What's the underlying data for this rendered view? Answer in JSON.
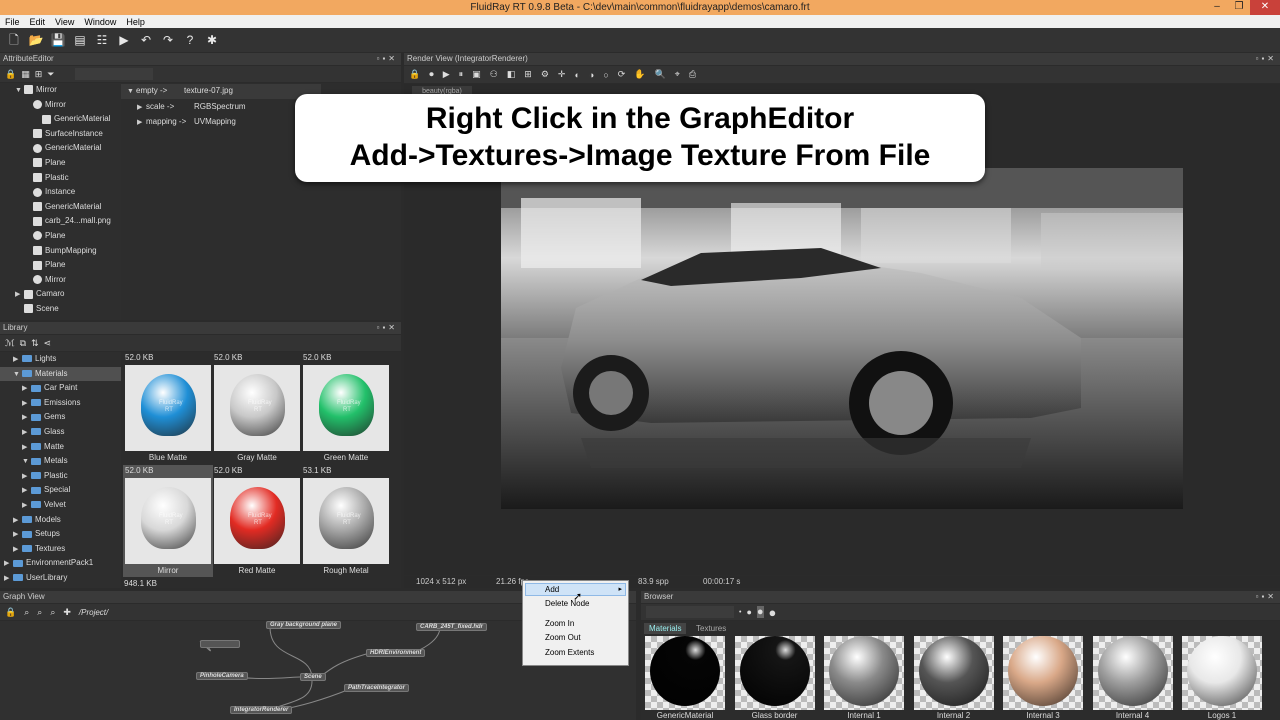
{
  "window": {
    "title": "FluidRay RT 0.9.8 Beta - C:\\dev\\main\\common\\fluidrayapp\\demos\\camaro.frt",
    "controls": [
      "–",
      "❐",
      "✕"
    ]
  },
  "menu": [
    "File",
    "Edit",
    "View",
    "Window",
    "Help"
  ],
  "attribute_editor": {
    "title": "AttributeEditor",
    "tree": [
      {
        "label": "Mirror",
        "indent": 1,
        "arrow": "▼"
      },
      {
        "label": "Mirror",
        "indent": 2,
        "arrow": ""
      },
      {
        "label": "GenericMaterial",
        "indent": 3,
        "arrow": ""
      },
      {
        "label": "SurfaceInstance",
        "indent": 2,
        "arrow": ""
      },
      {
        "label": "GenericMaterial",
        "indent": 2,
        "arrow": ""
      },
      {
        "label": "Plane",
        "indent": 2,
        "arrow": ""
      },
      {
        "label": "Plastic",
        "indent": 2,
        "arrow": ""
      },
      {
        "label": "Instance",
        "indent": 2,
        "arrow": ""
      },
      {
        "label": "GenericMaterial",
        "indent": 2,
        "arrow": ""
      },
      {
        "label": "carb_24...mall.png",
        "indent": 2,
        "arrow": ""
      },
      {
        "label": "Plane",
        "indent": 2,
        "arrow": ""
      },
      {
        "label": "BumpMapping",
        "indent": 2,
        "arrow": ""
      },
      {
        "label": "Plane",
        "indent": 2,
        "arrow": ""
      },
      {
        "label": "Mirror",
        "indent": 2,
        "arrow": ""
      },
      {
        "label": "Camaro",
        "indent": 1,
        "arrow": "▶"
      },
      {
        "label": "Scene",
        "indent": 1,
        "arrow": ""
      }
    ],
    "props": [
      {
        "key": "empty ->",
        "value": "texture-07.jpg",
        "arrow": "▼"
      },
      {
        "key": "scale ->",
        "value": "RGBSpectrum",
        "arrow": "▶"
      },
      {
        "key": "mapping ->",
        "value": "UVMapping",
        "arrow": "▶"
      }
    ]
  },
  "library": {
    "title": "Library",
    "tree": [
      {
        "label": "Lights",
        "indent": 1,
        "arrow": "▶"
      },
      {
        "label": "Materials",
        "indent": 1,
        "arrow": "▼",
        "selected": true
      },
      {
        "label": "Car Paint",
        "indent": 2,
        "arrow": "▶"
      },
      {
        "label": "Emissions",
        "indent": 2,
        "arrow": "▶"
      },
      {
        "label": "Gems",
        "indent": 2,
        "arrow": "▶"
      },
      {
        "label": "Glass",
        "indent": 2,
        "arrow": "▶"
      },
      {
        "label": "Matte",
        "indent": 2,
        "arrow": "▶"
      },
      {
        "label": "Metals",
        "indent": 2,
        "arrow": "▼"
      },
      {
        "label": "Plastic",
        "indent": 2,
        "arrow": "▶"
      },
      {
        "label": "Special",
        "indent": 2,
        "arrow": "▶"
      },
      {
        "label": "Velvet",
        "indent": 2,
        "arrow": "▶"
      },
      {
        "label": "Models",
        "indent": 1,
        "arrow": "▶"
      },
      {
        "label": "Setups",
        "indent": 1,
        "arrow": "▶"
      },
      {
        "label": "Textures",
        "indent": 1,
        "arrow": "▶"
      },
      {
        "label": "EnvironmentPack1",
        "indent": 0,
        "arrow": "▶"
      },
      {
        "label": "UserLibrary",
        "indent": 0,
        "arrow": "▶"
      }
    ],
    "items": [
      {
        "size": "52.0 KB",
        "name": "Blue Matte",
        "color": "#1f8fd6"
      },
      {
        "size": "52.0 KB",
        "name": "Gray Matte",
        "color": "#c8c8c8"
      },
      {
        "size": "52.0 KB",
        "name": "Green Matte",
        "color": "#22c06a"
      },
      {
        "size": "52.0 KB",
        "name": "Mirror",
        "color": "#d8d8d8"
      },
      {
        "size": "52.0 KB",
        "name": "Red Matte",
        "color": "#e22b23"
      },
      {
        "size": "53.1 KB",
        "name": "Rough Metal",
        "color": "#a8a8a8"
      }
    ],
    "footer_size": "948.1 KB",
    "thumb_logo": "FluidRay RT"
  },
  "render_view": {
    "title": "Render View (IntegratorRenderer)",
    "tab": "beauty(rgba)",
    "status": {
      "resolution": "1024 x 512 px",
      "time": "21.26 fps",
      "spp": "83.9 spp",
      "elapsed": "00:00:17 s"
    }
  },
  "overlay": {
    "line1": "Right Click in the GraphEditor",
    "line2": "Add->Textures->Image Texture From File"
  },
  "context_menu": {
    "items": [
      "Add",
      "Delete Node",
      "Zoom In",
      "Zoom Out",
      "Zoom Extents"
    ]
  },
  "graph_view": {
    "title": "Graph View",
    "path": "/Project/",
    "nodes": [
      "Gray background plane",
      "CARB_245T_fixed.hdr",
      "HDRIEnvironment",
      "PinholeCamera",
      "Scene",
      "PathTraceIntegrator",
      "IntegratorRenderer"
    ]
  },
  "browser": {
    "title": "Browser",
    "tabs": [
      "Materials",
      "Textures"
    ],
    "items": [
      {
        "name": "GenericMaterial",
        "color": "#050505"
      },
      {
        "name": "Glass border",
        "color": "#151515"
      },
      {
        "name": "Internal 1",
        "color": "#8a8a8a"
      },
      {
        "name": "Internal 2",
        "color": "#555555"
      },
      {
        "name": "Internal 3",
        "color": "#d9a888"
      },
      {
        "name": "Internal 4",
        "color": "#a0a0a0"
      },
      {
        "name": "Logos 1",
        "color": "#e8e8e8"
      }
    ]
  }
}
